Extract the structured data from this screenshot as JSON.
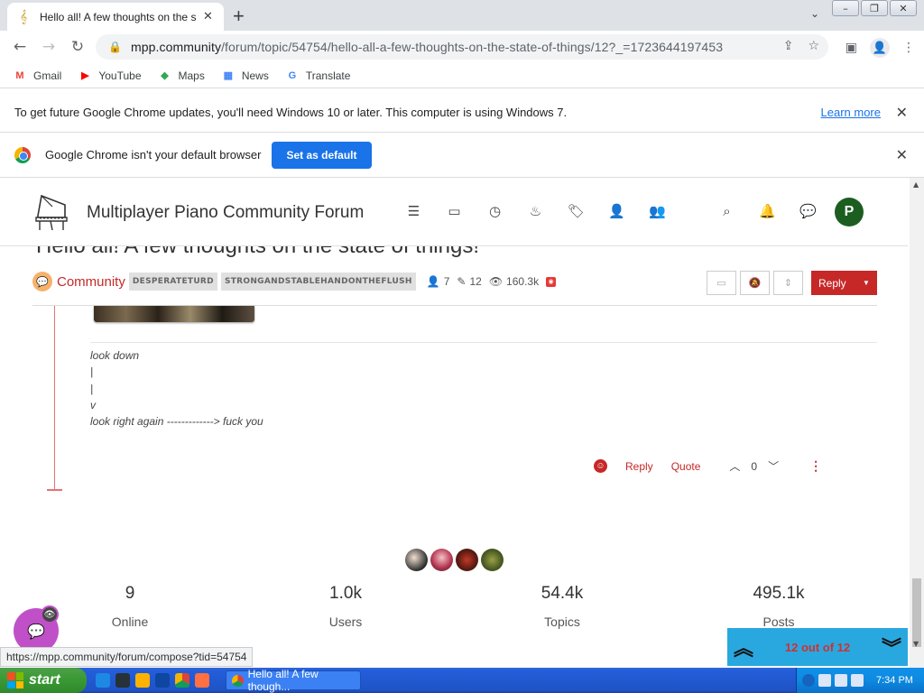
{
  "browser": {
    "tab_title": "Hello all! A few thoughts on the s",
    "url_host": "mpp.community",
    "url_path": "/forum/topic/54754/hello-all-a-few-thoughts-on-the-state-of-things/12?_=1723644197453",
    "bookmarks": [
      {
        "label": "Gmail",
        "icon": "gmail-icon",
        "color": "#ea4335"
      },
      {
        "label": "YouTube",
        "icon": "youtube-icon",
        "color": "#ff0000"
      },
      {
        "label": "Maps",
        "icon": "maps-icon",
        "color": "#34a853"
      },
      {
        "label": "News",
        "icon": "news-icon",
        "color": "#4285f4"
      },
      {
        "label": "Translate",
        "icon": "translate-icon",
        "color": "#4285f4"
      }
    ],
    "infobar_update": "To get future Google Chrome updates, you'll need Windows 10 or later. This computer is using Windows 7.",
    "infobar_learn_more": "Learn more",
    "infobar_default": "Google Chrome isn't your default browser",
    "set_default_label": "Set as default"
  },
  "forum": {
    "site_title": "Multiplayer Piano Community Forum",
    "avatar_letter": "P",
    "avatar_color": "#1b5e20",
    "topic_title": "Hello all! A few thoughts on the state of things!",
    "category": "Community",
    "tags": [
      "DESPERATETURD",
      "STRONGANDSTABLEHANDONTHEFLUSH"
    ],
    "posters": "7",
    "posts": "12",
    "views": "160.3k",
    "reply_label": "Reply",
    "accent": "#c62828",
    "post_lines": [
      "look down",
      "|",
      "|",
      "v",
      "look right again -------------> fuck you"
    ],
    "actions": {
      "reply": "Reply",
      "quote": "Quote",
      "votes": "0"
    },
    "stats": [
      {
        "num": "9",
        "label": "Online"
      },
      {
        "num": "1.0k",
        "label": "Users"
      },
      {
        "num": "54.4k",
        "label": "Topics"
      },
      {
        "num": "495.1k",
        "label": "Posts"
      }
    ],
    "pager_text": "12 out of 12"
  },
  "status_url": "https://mpp.community/forum/compose?tid=54754",
  "taskbar": {
    "start_label": "start",
    "task_label": "Hello all! A few though...",
    "clock": "7:34 PM"
  }
}
